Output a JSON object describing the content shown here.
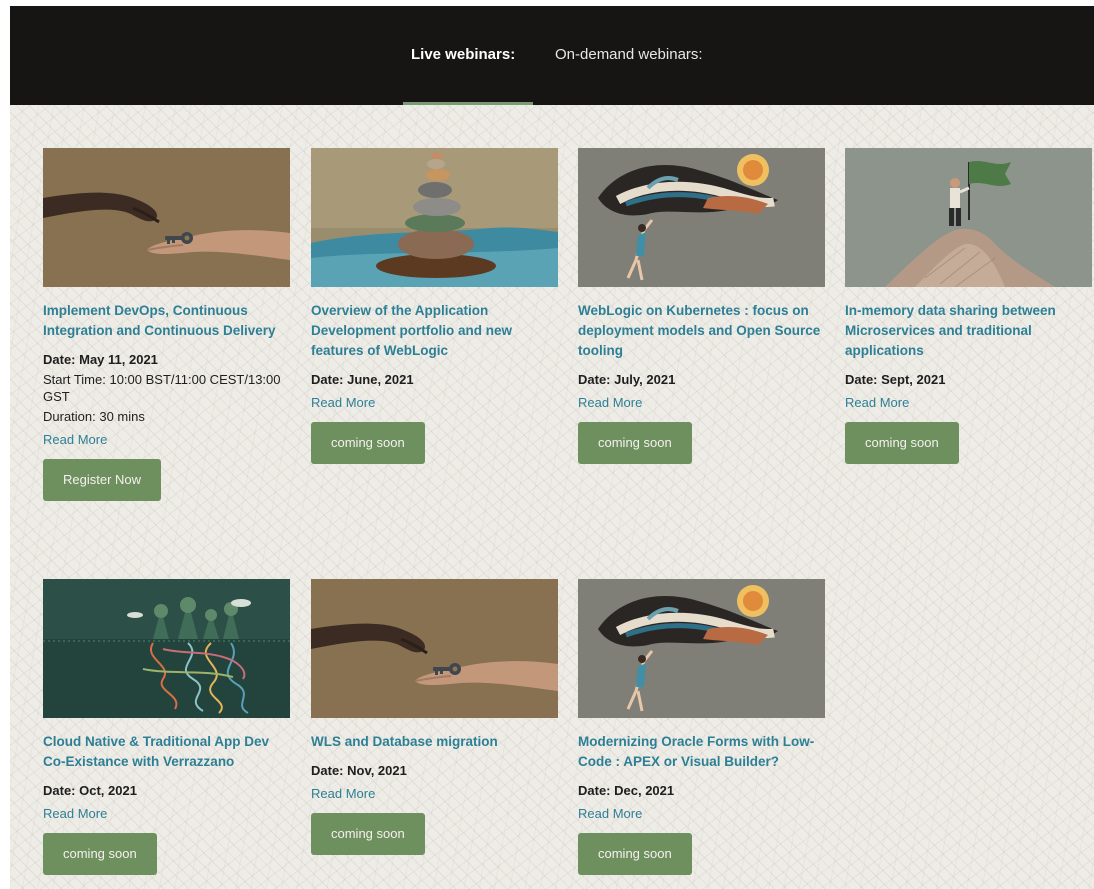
{
  "tabs": {
    "live_label": "Live webinars:",
    "ondemand_label": "On-demand webinars:"
  },
  "colors": {
    "header_bg": "#161513",
    "accent_green": "#6e8f5e",
    "link_blue": "#2d7f95",
    "page_bg": "#eeece6"
  },
  "cards": [
    {
      "title": "Implement DevOps, Continuous Integration and Continuous Delivery",
      "date": "Date: May 11, 2021",
      "start_time": "Start Time: 10:00 BST/11:00 CEST/13:00 GST",
      "duration": "Duration: 30 mins",
      "read_more": "Read More",
      "button": "Register Now",
      "image": "hands-key-illustration"
    },
    {
      "title": "Overview of the Application Development portfolio and new features of WebLogic",
      "date": "Date: June, 2021",
      "read_more": "Read More",
      "button": "coming soon",
      "image": "stacked-stones-illustration"
    },
    {
      "title": "WebLogic on Kubernetes : focus on deployment models and Open Source tooling",
      "date": "Date: July, 2021",
      "read_more": "Read More",
      "button": "coming soon",
      "image": "flying-woman-illustration"
    },
    {
      "title": "In-memory data sharing between Microservices and traditional applications",
      "date": "Date: Sept, 2021",
      "read_more": "Read More",
      "button": "coming soon",
      "image": "summit-flag-illustration"
    },
    {
      "title": "Cloud Native & Traditional App Dev Co-Existance with Verrazzano",
      "date": "Date: Oct, 2021",
      "read_more": "Read More",
      "button": "coming soon",
      "image": "forest-roots-illustration"
    },
    {
      "title": "WLS and Database migration",
      "date": "Date: Nov, 2021",
      "read_more": "Read More",
      "button": "coming soon",
      "image": "hands-key-illustration"
    },
    {
      "title": "Modernizing Oracle Forms with Low-Code : APEX or Visual Builder?",
      "date": "Date: Dec, 2021",
      "read_more": "Read More",
      "button": "coming soon",
      "image": "flying-woman-illustration"
    }
  ]
}
